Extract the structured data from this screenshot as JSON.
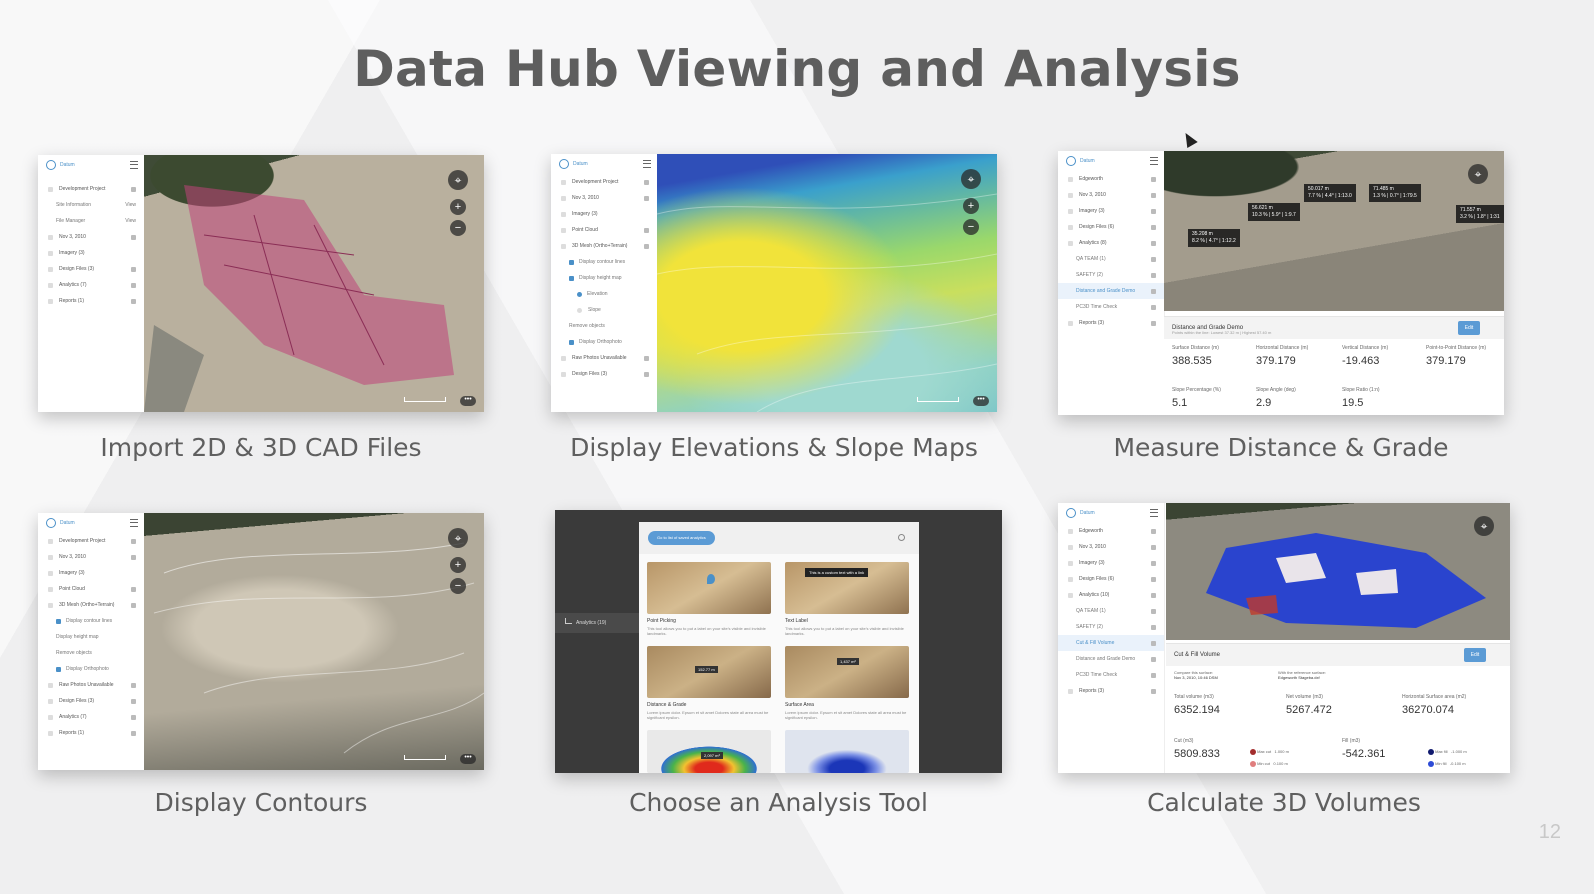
{
  "slide": {
    "title": "Data Hub Viewing and Analysis",
    "page_number": "12"
  },
  "captions": {
    "c1": "Import 2D & 3D CAD Files",
    "c2": "Display Elevations & Slope Maps",
    "c3": "Measure Distance & Grade",
    "c4": "Display Contours",
    "c5": "Choose an Analysis Tool",
    "c6": "Calculate 3D Volumes"
  },
  "s1": {
    "brand": "Datum",
    "rows": [
      "Development Project",
      "Site Information",
      "File Manager",
      "Nov 3, 2010",
      "Imagery (3)",
      "Design Files (3)",
      "Analytics (7)",
      "Reports (1)"
    ],
    "view": "View"
  },
  "s2": {
    "brand": "Datum",
    "rows": [
      "Development Project",
      "Nov 3, 2010",
      "Imagery (3)",
      "Point Cloud",
      "3D Mesh (Ortho+Terrain)",
      "Display contour lines",
      "Display height map",
      "Elevation",
      "Slope",
      "Remove objects",
      "Display Orthophoto",
      "Raw Photos Unavailable",
      "Design Files (3)"
    ]
  },
  "s3": {
    "brand": "Datum",
    "rows": [
      "Edgeworth",
      "Nov 3, 2010",
      "Imagery (3)",
      "Design Files (6)",
      "Analytics (8)",
      "QA TEAM (1)",
      "SAFETY (2)",
      "Distance and Grade Demo",
      "PC3D Time Check",
      "Reports (3)"
    ],
    "labels": [
      "50.017 m\n7.7 % | 4.4° | 1:13.0",
      "71.485 m\n1.3 % | 0.7° | 1:79.5",
      "56.621 m\n10.3 % | 5.9° | 1:9.7",
      "35.208 m\n8.2 % | 4.7° | 1:12.2",
      "71.557 m\n3.2 % | 1.8° | 1:31"
    ],
    "panel_title": "Distance and Grade Demo",
    "panel_sub": "Points within the line: Lowest 37.32 m | Highest 57.40 m",
    "edit": "Edit",
    "stats": [
      {
        "label": "Surface Distance (m)",
        "value": "388.535"
      },
      {
        "label": "Horizontal Distance (m)",
        "value": "379.179"
      },
      {
        "label": "Vertical Distance (m)",
        "value": "-19.463"
      },
      {
        "label": "Point-to-Point Distance (m)",
        "value": "379.179"
      },
      {
        "label": "Slope Percentage (%)",
        "value": "5.1"
      },
      {
        "label": "Slope Angle (deg)",
        "value": "2.9"
      },
      {
        "label": "Slope Ratio (1:n)",
        "value": "19.5"
      }
    ]
  },
  "s4": {
    "brand": "Datum",
    "rows": [
      "Development Project",
      "Nov 3, 2010",
      "Imagery (3)",
      "Point Cloud",
      "3D Mesh (Ortho+Terrain)",
      "Display contour lines",
      "Display height map",
      "Remove objects",
      "Display Orthophoto",
      "Raw Photos Unavailable",
      "Design Files (3)",
      "Analytics (7)",
      "Reports (1)"
    ]
  },
  "s5": {
    "back_button": "Go to list of saved analytics",
    "side_item": "Analytics (19)",
    "tooltip": "This is a custom text with a link",
    "cards": [
      {
        "title": "Point Picking",
        "desc": "This tool allows you to put a label on your site's visible and invisible landmarks."
      },
      {
        "title": "Text Label",
        "desc": "This tool allows you to put a label on your site's visible and invisible landmarks."
      },
      {
        "title": "Distance & Grade",
        "desc": "Lorem ipsum dolor. Epsum et sit amet Dolores state all area must be significant epsilon."
      },
      {
        "title": "Surface Area",
        "desc": "Lorem ipsum dolor. Epsum et sit amet Dolores state all area must be significant epsilon."
      }
    ],
    "card_badge_a": "152.77 m",
    "card_badge_b": "1,437 m²",
    "card_badge_c": "2,097 m³"
  },
  "s6": {
    "brand": "Datum",
    "rows": [
      "Edgeworth",
      "Nov 3, 2010",
      "Imagery (3)",
      "Design Files (6)",
      "Analytics (10)",
      "QA TEAM (1)",
      "SAFETY (2)",
      "Cut & Fill Volume",
      "Distance and Grade Demo",
      "PC3D Time Check",
      "Reports (3)"
    ],
    "panel_title": "Cut & Fill Volume",
    "edit": "Edit",
    "compare_label": "Compare this surface:",
    "compare_value": "Nov 3, 2010, 10:46 DSM",
    "ref_label": "With the reference surface:",
    "ref_value": "Edgeworth Stageba.dxf",
    "stats": [
      {
        "label": "Total volume (m3)",
        "value": "6352.194"
      },
      {
        "label": "Net volume (m3)",
        "value": "5267.472"
      },
      {
        "label": "Horizontal Surface area (m2)",
        "value": "36270.074"
      },
      {
        "label": "Cut (m3)",
        "value": "5809.833"
      },
      {
        "label": "Fill (m3)",
        "value": "-542.361"
      }
    ],
    "legend": [
      "Max cut",
      "1.000 m",
      "Min cut",
      "0.100 m",
      "Max fill",
      "-1.000 m",
      "Min fill",
      "-0.100 m"
    ]
  },
  "common": {
    "scale_text": "10 m",
    "more": "•••",
    "compass": "⌖",
    "zoom_in": "+",
    "zoom_out": "−"
  },
  "colors": {
    "title": "#5e5e5e",
    "caption": "#5f5f5f",
    "accent": "#4a90c8",
    "cut": "#c0392b",
    "fill": "#1f3cd6"
  }
}
